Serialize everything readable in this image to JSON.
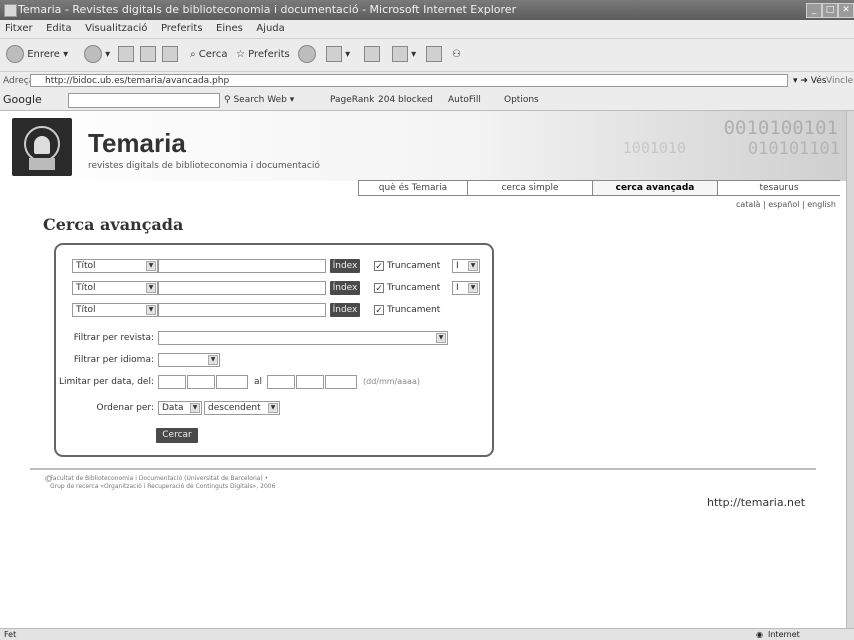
{
  "window": {
    "title": "Temaria - Revistes digitals de biblioteconomia i documentació - Microsoft Internet Explorer",
    "minimize": "_",
    "maximize": "□",
    "close": "✕"
  },
  "menubar": {
    "items": [
      "Fitxer",
      "Edita",
      "Visualització",
      "Preferits",
      "Eines",
      "Ajuda"
    ]
  },
  "toolbar": {
    "back_label": "Enrere",
    "search_label": "Cerca",
    "favorites_label": "Preferits"
  },
  "addressbar": {
    "label": "Adreça",
    "url": "http://bidoc.ub.es/temaria/avancada.php",
    "go_label": "Vés",
    "links_label": "Vincle"
  },
  "googlebar": {
    "label": "Google",
    "search_web_label": "Search Web",
    "pagerank_label": "PageRank",
    "blocked_label": "204 blocked",
    "autofill_label": "AutoFill",
    "options_label": "Options"
  },
  "site": {
    "brand": "Temaria",
    "tagline": "revistes digitals de biblioteconomia i documentació",
    "nav": [
      "què és Temaria",
      "cerca simple",
      "cerca avançada",
      "tesaurus"
    ],
    "active_nav": "cerca avançada",
    "langs": "català | español | english",
    "page_title": "Cerca avançada",
    "binary_1": "0010100101",
    "binary_2": "010101101",
    "binary_3": "1001010"
  },
  "form": {
    "rows": [
      {
        "field": "Títol",
        "index_label": "Índex",
        "truncate_label": "Truncament",
        "operator": "I"
      },
      {
        "field": "Títol",
        "index_label": "Índex",
        "truncate_label": "Truncament",
        "operator": "I"
      },
      {
        "field": "Títol",
        "index_label": "Índex",
        "truncate_label": "Truncament"
      }
    ],
    "filter_journal_label": "Filtrar per revista:",
    "filter_language_label": "Filtrar per idioma:",
    "date_limit_label": "Limitar per data, del:",
    "date_to_label": "al",
    "date_hint": "(dd/mm/aaaa)",
    "order_label": "Ordenar per:",
    "order_field": "Data",
    "order_dir": "descendent",
    "submit_label": "Cercar"
  },
  "footer": {
    "copyright_symbol": "©",
    "credits_1": "Facultat de Biblioteconomia i Documentació (Universitat de Barcelona) •",
    "credits_2": "Grup de recerca «Organització i Recuperació de Continguts Digitals», 2006",
    "url": "http://temaria.net"
  },
  "status": {
    "left": "Fet",
    "zone": "Internet"
  }
}
